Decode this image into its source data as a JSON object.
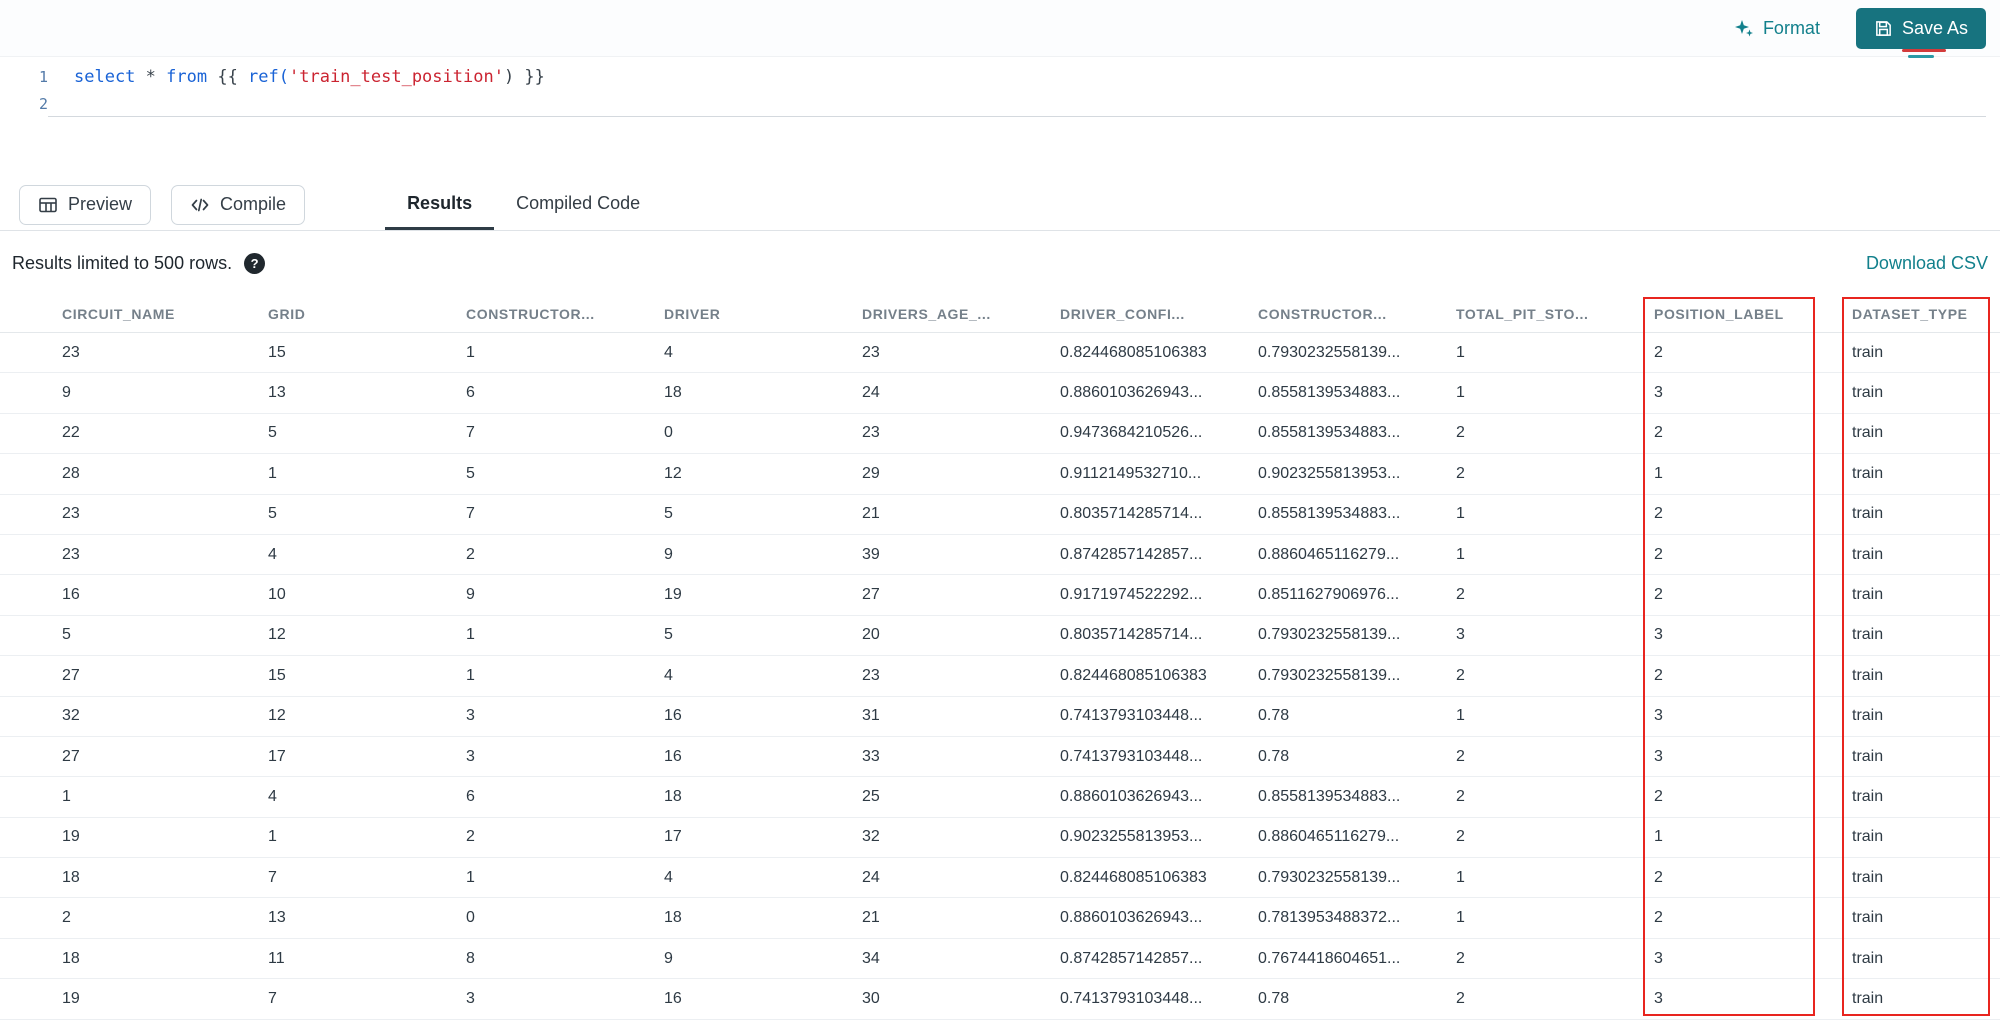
{
  "topbar": {
    "format_label": "Format",
    "save_as_label": "Save As"
  },
  "editor": {
    "line_numbers": [
      "1",
      "2"
    ],
    "code_line": {
      "kw1": "select",
      "op1": " * ",
      "kw2": "from",
      "punct_open": " {{ ",
      "fn": "ref(",
      "string": "'train_test_position'",
      "punct_close": ") }}"
    }
  },
  "actions": {
    "preview_label": "Preview",
    "compile_label": "Compile"
  },
  "tabs": {
    "results_label": "Results",
    "compiled_label": "Compiled Code"
  },
  "results": {
    "limit_text": "Results limited to 500 rows.",
    "download_label": "Download CSV",
    "columns": [
      "CIRCUIT_NAME",
      "GRID",
      "CONSTRUCTOR...",
      "DRIVER",
      "DRIVERS_AGE_...",
      "DRIVER_CONFI...",
      "CONSTRUCTOR...",
      "TOTAL_PIT_STO...",
      "POSITION_LABEL",
      "DATASET_TYPE"
    ],
    "highlighted_columns": [
      "POSITION_LABEL",
      "DATASET_TYPE"
    ],
    "rows": [
      [
        "23",
        "15",
        "1",
        "4",
        "23",
        "0.824468085106383",
        "0.7930232558139...",
        "1",
        "2",
        "train"
      ],
      [
        "9",
        "13",
        "6",
        "18",
        "24",
        "0.8860103626943...",
        "0.8558139534883...",
        "1",
        "3",
        "train"
      ],
      [
        "22",
        "5",
        "7",
        "0",
        "23",
        "0.9473684210526...",
        "0.8558139534883...",
        "2",
        "2",
        "train"
      ],
      [
        "28",
        "1",
        "5",
        "12",
        "29",
        "0.9112149532710...",
        "0.9023255813953...",
        "2",
        "1",
        "train"
      ],
      [
        "23",
        "5",
        "7",
        "5",
        "21",
        "0.8035714285714...",
        "0.8558139534883...",
        "1",
        "2",
        "train"
      ],
      [
        "23",
        "4",
        "2",
        "9",
        "39",
        "0.8742857142857...",
        "0.8860465116279...",
        "1",
        "2",
        "train"
      ],
      [
        "16",
        "10",
        "9",
        "19",
        "27",
        "0.9171974522292...",
        "0.8511627906976...",
        "2",
        "2",
        "train"
      ],
      [
        "5",
        "12",
        "1",
        "5",
        "20",
        "0.8035714285714...",
        "0.7930232558139...",
        "3",
        "3",
        "train"
      ],
      [
        "27",
        "15",
        "1",
        "4",
        "23",
        "0.824468085106383",
        "0.7930232558139...",
        "2",
        "2",
        "train"
      ],
      [
        "32",
        "12",
        "3",
        "16",
        "31",
        "0.7413793103448...",
        "0.78",
        "1",
        "3",
        "train"
      ],
      [
        "27",
        "17",
        "3",
        "16",
        "33",
        "0.7413793103448...",
        "0.78",
        "2",
        "3",
        "train"
      ],
      [
        "1",
        "4",
        "6",
        "18",
        "25",
        "0.8860103626943...",
        "0.8558139534883...",
        "2",
        "2",
        "train"
      ],
      [
        "19",
        "1",
        "2",
        "17",
        "32",
        "0.9023255813953...",
        "0.8860465116279...",
        "2",
        "1",
        "train"
      ],
      [
        "18",
        "7",
        "1",
        "4",
        "24",
        "0.824468085106383",
        "0.7930232558139...",
        "1",
        "2",
        "train"
      ],
      [
        "2",
        "13",
        "0",
        "18",
        "21",
        "0.8860103626943...",
        "0.7813953488372...",
        "1",
        "2",
        "train"
      ],
      [
        "18",
        "11",
        "8",
        "9",
        "34",
        "0.8742857142857...",
        "0.7674418604651...",
        "2",
        "3",
        "train"
      ],
      [
        "19",
        "7",
        "3",
        "16",
        "30",
        "0.7413793103448...",
        "0.78",
        "2",
        "3",
        "train"
      ]
    ]
  },
  "colors": {
    "accent_teal": "#12808c",
    "save_button": "#17737f",
    "highlight_red": "#e8251f"
  }
}
